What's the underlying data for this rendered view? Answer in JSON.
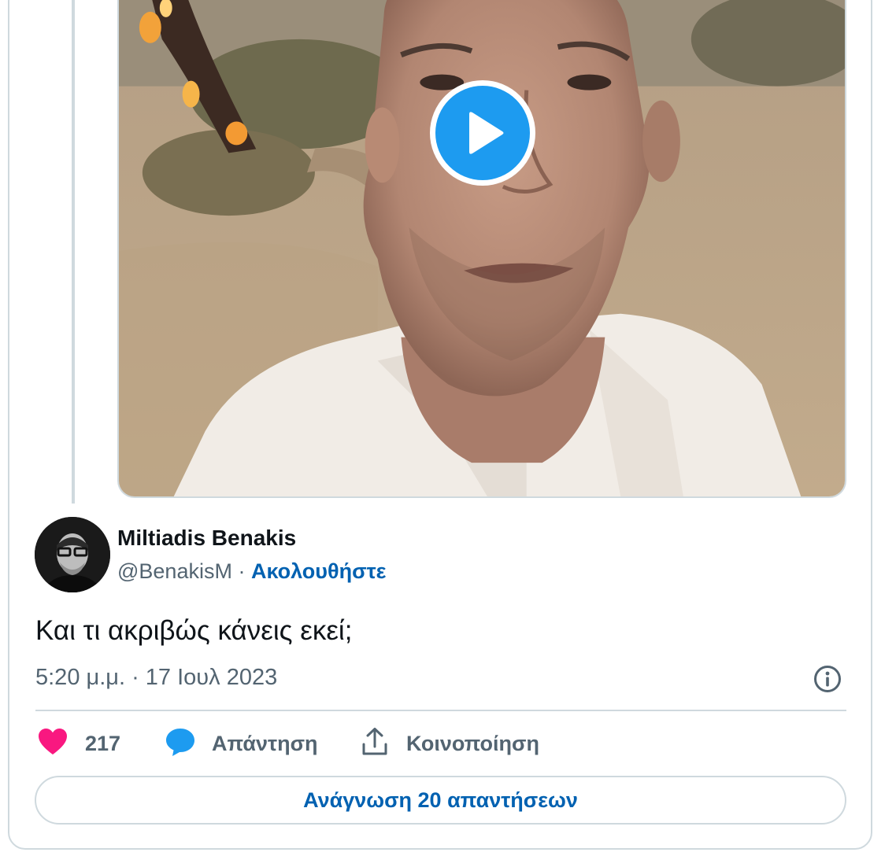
{
  "tweet": {
    "author_name": "Miltiadis Benakis",
    "handle": "@BenakisM",
    "separator": " · ",
    "follow_label": "Ακολουθήστε",
    "text": "Και τι ακριβώς κάνεις εκεί;",
    "timestamp": "5:20 μ.μ. · 17 Ιουλ 2023"
  },
  "actions": {
    "like_count": "217",
    "reply_label": "Απάντηση",
    "share_label": "Κοινοποίηση"
  },
  "read_replies_label": "Ανάγνωση 20 απαντήσεων",
  "icons": {
    "like": "heart-icon",
    "reply": "speech-bubble-icon",
    "share": "upload-icon",
    "info": "info-icon",
    "play": "play-icon"
  },
  "colors": {
    "like": "#f91880",
    "reply": "#1d9bf0",
    "link": "#0061b1",
    "play": "#1d9bf0",
    "muted": "#536471"
  }
}
